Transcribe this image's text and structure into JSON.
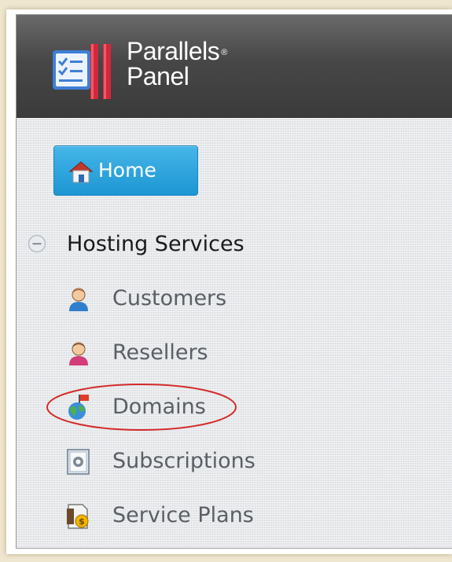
{
  "brand": {
    "name_line1": "Parallels",
    "registered_mark": "®",
    "name_line2": "Panel"
  },
  "nav": {
    "home_label": "Home",
    "section_label": "Hosting Services",
    "section_state": "expanded",
    "items": [
      {
        "label": "Customers",
        "icon": "customer-icon"
      },
      {
        "label": "Resellers",
        "icon": "reseller-icon"
      },
      {
        "label": "Domains",
        "icon": "domains-globe-icon",
        "annotated": true
      },
      {
        "label": "Subscriptions",
        "icon": "subscriptions-icon"
      },
      {
        "label": "Service Plans",
        "icon": "service-plans-icon"
      }
    ]
  },
  "colors": {
    "header": "#474747",
    "home_button": "#1d96d3",
    "annotation": "#d42a2a",
    "item_text": "#5a5f66"
  }
}
